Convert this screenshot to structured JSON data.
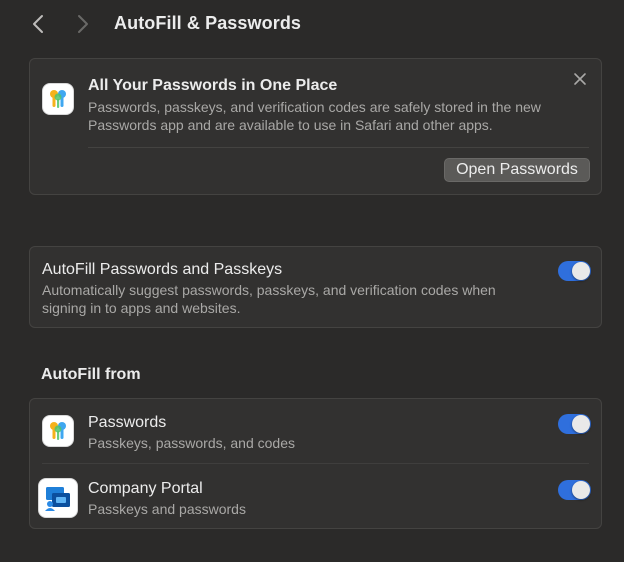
{
  "window": {
    "title": "AutoFill & Passwords",
    "back_icon": "chevron-left-icon",
    "forward_icon": "chevron-right-icon"
  },
  "promo": {
    "icon": "passwords-app-icon",
    "title": "All Your Passwords in One Place",
    "body": "Passwords, passkeys, and verification codes are safely stored in the new Passwords app and are available to use in Safari and other apps.",
    "button_label": "Open Passwords",
    "close_icon": "close-icon"
  },
  "autofill_setting": {
    "title": "AutoFill Passwords and Passkeys",
    "description": "Automatically suggest passwords, passkeys, and verification codes when signing in to apps and websites.",
    "enabled": true
  },
  "sources": {
    "label": "AutoFill from",
    "items": [
      {
        "icon": "passwords-app-icon",
        "title": "Passwords",
        "subtitle": "Passkeys, passwords, and codes",
        "enabled": true
      },
      {
        "icon": "company-portal-icon",
        "title": "Company Portal",
        "subtitle": "Passkeys and passwords",
        "enabled": true
      }
    ]
  },
  "colors": {
    "background": "#2b2a29",
    "card": "#323130",
    "accent": "#2f6fdd",
    "secondary_text": "#a9a8a6"
  }
}
